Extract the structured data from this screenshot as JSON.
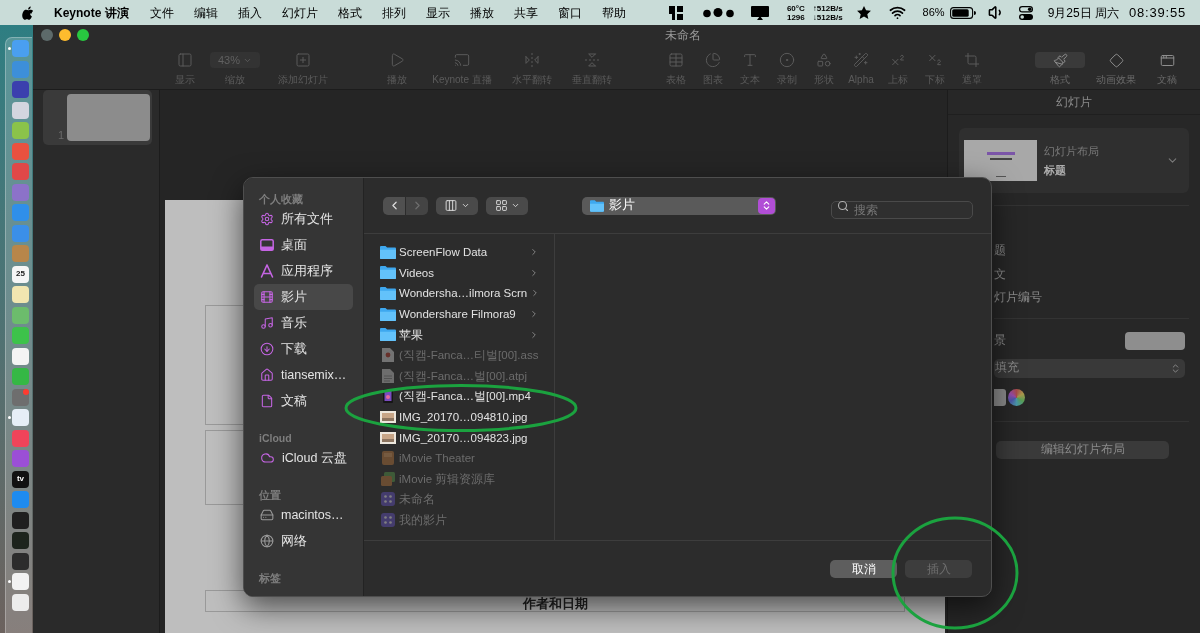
{
  "menu_bar": {
    "app_name": "Keynote 讲演",
    "menus": [
      "文件",
      "编辑",
      "插入",
      "幻灯片",
      "格式",
      "排列",
      "显示",
      "播放",
      "共享",
      "窗口",
      "帮助"
    ],
    "temperature": "60°C",
    "fan_speed": "1296",
    "upload": "↑512B/s",
    "download": "↓512B/s",
    "battery": "86%",
    "date": "9月25日 周六",
    "time": "08:39:55"
  },
  "dock": {
    "apps": [
      {
        "color": "#4a9ff0",
        "running": true,
        "badge": false
      },
      {
        "color": "#3d8fd9",
        "running": false,
        "badge": false
      },
      {
        "color": "#3b3fae",
        "running": false,
        "badge": false
      },
      {
        "color": "#d3d6df",
        "running": false,
        "badge": false
      },
      {
        "color": "#8bc34a",
        "running": false,
        "badge": false
      },
      {
        "color": "#e9513f",
        "running": false,
        "badge": false
      },
      {
        "color": "#e04848",
        "running": false,
        "badge": false
      },
      {
        "color": "#8c72c9",
        "running": false,
        "badge": false
      },
      {
        "color": "#2f8fea",
        "running": false,
        "badge": false
      },
      {
        "color": "#3b8fe8",
        "running": false,
        "badge": false
      },
      {
        "color": "#b8864a",
        "running": false,
        "badge": false
      },
      {
        "color": "#f6f6f6",
        "running": false,
        "badge": false,
        "text": "25"
      },
      {
        "color": "#f2e6b0",
        "running": false,
        "badge": false
      },
      {
        "color": "#6cbc6c",
        "running": false,
        "badge": false
      },
      {
        "color": "#3dc24a",
        "running": false,
        "badge": false
      },
      {
        "color": "#f4f4f4",
        "running": false,
        "badge": false
      },
      {
        "color": "#35b845",
        "running": false,
        "badge": false
      },
      {
        "color": "#6e6e6e",
        "running": false,
        "badge": true
      },
      {
        "color": "#e6eef6",
        "running": true,
        "badge": false
      },
      {
        "color": "#f0445a",
        "running": false,
        "badge": false
      },
      {
        "color": "#9b4fd6",
        "running": false,
        "badge": false
      },
      {
        "color": "#111111",
        "running": false,
        "badge": false,
        "text": "tv"
      },
      {
        "color": "#1e8bf0",
        "running": false,
        "badge": false
      },
      {
        "color": "#1f1f1f",
        "running": false,
        "badge": false
      },
      {
        "color": "#1d241d",
        "running": false,
        "badge": false
      },
      {
        "color": "#2c2c2c",
        "running": false,
        "badge": false
      },
      {
        "color": "#f2f2f2",
        "running": true,
        "badge": false
      },
      {
        "color": "#ececec",
        "running": false,
        "badge": false
      }
    ]
  },
  "window": {
    "title": "未命名",
    "window_controls": [
      {
        "disabled": true
      },
      {
        "disabled": false
      },
      {
        "disabled": false
      }
    ],
    "toolbar": {
      "groups": [
        {
          "items": [
            {
              "label": "显示"
            },
            {
              "label": "缩放",
              "value": "43%"
            },
            {
              "label": "添加幻灯片"
            }
          ]
        },
        {
          "items": [
            {
              "label": "播放"
            },
            {
              "label": "Keynote 直播"
            },
            {
              "label": "水平翻转"
            },
            {
              "label": "垂直翻转"
            }
          ]
        },
        {
          "items": [
            {
              "label": "表格"
            },
            {
              "label": "图表"
            },
            {
              "label": "文本"
            },
            {
              "label": "录制"
            },
            {
              "label": "形状"
            },
            {
              "label": "Alpha"
            },
            {
              "label": "上标"
            },
            {
              "label": "下标"
            },
            {
              "label": "遮罩"
            }
          ]
        }
      ],
      "inspector_tabs": [
        {
          "label": "格式",
          "selected": true
        },
        {
          "label": "动画效果",
          "selected": false
        },
        {
          "label": "文稿",
          "selected": false
        }
      ]
    },
    "slides": [
      {
        "number": "1",
        "selected": true
      }
    ],
    "slide": {
      "footer": "作者和日期"
    },
    "inspector": {
      "title": "幻灯片",
      "layout_label": "幻灯片布局",
      "layout_value": "标题",
      "options": [
        "题",
        "文",
        "灯片编号"
      ],
      "background_label": "景",
      "fill": "填充",
      "edit_button": "编辑幻灯片布局"
    }
  },
  "file_dialog": {
    "sidebar": [
      {
        "title": "个人收藏",
        "items": [
          {
            "label": "所有文件",
            "selected": false
          },
          {
            "label": "桌面",
            "selected": false
          },
          {
            "label": "应用程序",
            "selected": false
          },
          {
            "label": "影片",
            "selected": true
          },
          {
            "label": "音乐",
            "selected": false
          },
          {
            "label": "下载",
            "selected": false
          },
          {
            "label": "tiansemix…",
            "selected": false
          },
          {
            "label": "文稿",
            "selected": false
          }
        ]
      },
      {
        "title": "iCloud",
        "items": [
          {
            "label": "iCloud 云盘",
            "selected": false
          }
        ]
      },
      {
        "title": "位置",
        "items": [
          {
            "label": "macintos…",
            "selected": false
          },
          {
            "label": "网络",
            "selected": false
          }
        ]
      },
      {
        "title": "标签"
      }
    ],
    "back": {
      "disabled": false
    },
    "forward": {
      "disabled": true
    },
    "location": "影片",
    "search": {
      "placeholder": "搜索"
    },
    "files": [
      {
        "kind": "folder",
        "name": "ScreenFlow Data",
        "disabled": false
      },
      {
        "kind": "folder",
        "name": "Videos",
        "disabled": false
      },
      {
        "kind": "folder",
        "name": "Wondersha…ilmora Scrn",
        "disabled": false
      },
      {
        "kind": "folder",
        "name": "Wondershare Filmora9",
        "disabled": false
      },
      {
        "kind": "folder",
        "name": "苹果",
        "disabled": false
      },
      {
        "kind": "subtitle",
        "name": "(직캠-Fanca…티벌[00].ass",
        "disabled": true
      },
      {
        "kind": "document",
        "name": "(직캠-Fanca…벌[00].atpj",
        "disabled": true
      },
      {
        "kind": "video",
        "name": "(직캠-Fanca…벌[00].mp4",
        "disabled": false
      },
      {
        "kind": "image",
        "name": "IMG_20170…094810.jpg",
        "disabled": false
      },
      {
        "kind": "image",
        "name": "IMG_20170…094823.jpg",
        "disabled": false
      },
      {
        "kind": "theater",
        "name": "iMovie Theater",
        "disabled": true
      },
      {
        "kind": "library",
        "name": "iMovie 剪辑资源库",
        "disabled": true
      },
      {
        "kind": "project",
        "name": "未命名",
        "disabled": true
      },
      {
        "kind": "project",
        "name": "我的影片",
        "disabled": true
      }
    ],
    "buttons": [
      {
        "label": "取消",
        "disabled": false
      },
      {
        "label": "插入",
        "disabled": true
      }
    ]
  },
  "annotations": [
    {
      "kind": "ellipse"
    },
    {
      "kind": "ellipse"
    }
  ]
}
